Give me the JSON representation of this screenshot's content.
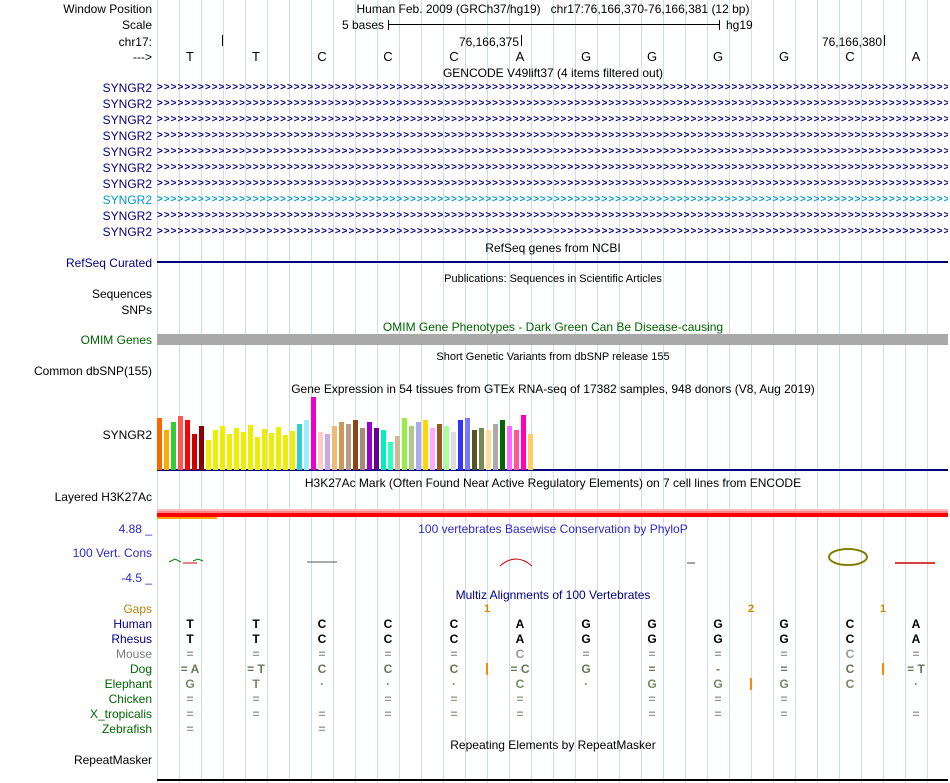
{
  "header": {
    "window_position_label": "Window Position",
    "assembly_text": "Human Feb. 2009 (GRCh37/hg19)",
    "position_text": "chr17:76,166,370-76,166,381 (12 bp)",
    "scale_label": "Scale",
    "scale_bar_text": "5 bases",
    "scale_right_text": "hg19",
    "chrom_label": "chr17:",
    "ruler_labels": [
      "76,166,375",
      "76,166,380"
    ],
    "strand_label": "--->",
    "bases": [
      "T",
      "T",
      "C",
      "C",
      "C",
      "A",
      "G",
      "G",
      "G",
      "G",
      "C",
      "A"
    ]
  },
  "gencode": {
    "title": "GENCODE V49lift37 (4 items filtered out)",
    "genes": [
      {
        "label": "SYNGR2",
        "color": "#000080"
      },
      {
        "label": "SYNGR2",
        "color": "#000080"
      },
      {
        "label": "SYNGR2",
        "color": "#000080"
      },
      {
        "label": "SYNGR2",
        "color": "#000080"
      },
      {
        "label": "SYNGR2",
        "color": "#000080"
      },
      {
        "label": "SYNGR2",
        "color": "#000080"
      },
      {
        "label": "SYNGR2",
        "color": "#000080"
      },
      {
        "label": "SYNGR2",
        "color": "#009ACD"
      },
      {
        "label": "SYNGR2",
        "color": "#000080"
      },
      {
        "label": "SYNGR2",
        "color": "#000080"
      }
    ]
  },
  "refseq": {
    "title": "RefSeq genes from NCBI",
    "label": "RefSeq Curated",
    "color": "#000080"
  },
  "publications": {
    "title": "Publications: Sequences in Scientific Articles",
    "row_labels": [
      "Sequences",
      "SNPs"
    ]
  },
  "omim": {
    "title": "OMIM Gene Phenotypes - Dark Green Can Be Disease-causing",
    "label": "OMIM Genes",
    "bar_color": "#A9A9A9"
  },
  "dbsnp": {
    "title": "Short Genetic Variants from dbSNP release 155",
    "label": "Common dbSNP(155)"
  },
  "gtex": {
    "title": "Gene Expression in 54 tissues from GTEx RNA-seq of 17382 samples, 948 donors (V8, Aug 2019)",
    "label": "SYNGR2",
    "baseline_color": "#000080",
    "bars": [
      [
        52,
        "#FF6600"
      ],
      [
        40,
        "#FFAA00"
      ],
      [
        48,
        "#33CC33"
      ],
      [
        54,
        "#FF5555"
      ],
      [
        50,
        "#FF0000"
      ],
      [
        36,
        "#CC0000"
      ],
      [
        44,
        "#8B0000"
      ],
      [
        30,
        "#EEEE00"
      ],
      [
        40,
        "#EEEE00"
      ],
      [
        44,
        "#EEEE00"
      ],
      [
        36,
        "#EEEE00"
      ],
      [
        42,
        "#EEEE00"
      ],
      [
        38,
        "#EEEE00"
      ],
      [
        45,
        "#EEEE00"
      ],
      [
        33,
        "#EEEE00"
      ],
      [
        41,
        "#EEEE00"
      ],
      [
        37,
        "#EEEE00"
      ],
      [
        43,
        "#EEEE00"
      ],
      [
        35,
        "#EEEE00"
      ],
      [
        39,
        "#EEEE00"
      ],
      [
        46,
        "#33CCCC"
      ],
      [
        50,
        "#99EEFF"
      ],
      [
        73,
        "#EE00CC"
      ],
      [
        38,
        "#FFCCCC"
      ],
      [
        36,
        "#CCAADD"
      ],
      [
        44,
        "#EEBB77"
      ],
      [
        48,
        "#CC9955"
      ],
      [
        46,
        "#BB9988"
      ],
      [
        50,
        "#8B4513"
      ],
      [
        42,
        "#AA8877"
      ],
      [
        48,
        "#9900CC"
      ],
      [
        42,
        "#660099"
      ],
      [
        40,
        "#00EEBB"
      ],
      [
        28,
        "#33FFC2"
      ],
      [
        34,
        "#CCBB99"
      ],
      [
        52,
        "#99EE44"
      ],
      [
        44,
        "#AACC88"
      ],
      [
        48,
        "#AAAAEE"
      ],
      [
        50,
        "#FFD700"
      ],
      [
        42,
        "#FFAAFF"
      ],
      [
        46,
        "#995522"
      ],
      [
        44,
        "#AAFF99"
      ],
      [
        38,
        "#DDDDDD"
      ],
      [
        50,
        "#3333FF"
      ],
      [
        52,
        "#7777FF"
      ],
      [
        40,
        "#555522"
      ],
      [
        42,
        "#778855"
      ],
      [
        40,
        "#FFDD99"
      ],
      [
        46,
        "#AAAAAA"
      ],
      [
        50,
        "#006600"
      ],
      [
        44,
        "#FF66FF"
      ],
      [
        40,
        "#FF5599"
      ],
      [
        55,
        "#FF00BB"
      ],
      [
        36,
        "#FFCC66"
      ]
    ]
  },
  "h3k27ac": {
    "title": "H3K27Ac Mark (Often Found Near Active Regulatory Elements) on 7 cell lines from ENCODE",
    "label": "Layered H3K27Ac"
  },
  "phylop": {
    "title": "100 vertebrates Basewise Conservation by PhyloP",
    "label": "100 Vert. Cons",
    "max_label": "4.88 _",
    "min_label": "-4.5 _"
  },
  "multiz": {
    "title": "Multiz Alignments of 100 Vertebrates",
    "gaps": {
      "label": "Gaps",
      "color": "#CC8800",
      "marks": [
        {
          "boundary": 5,
          "text": "1"
        },
        {
          "boundary": 9,
          "text": "2"
        },
        {
          "boundary": 11,
          "text": "1"
        }
      ]
    },
    "species": [
      {
        "name": "Human",
        "label_color": "#000080",
        "base_color": "#000000",
        "bases": [
          "T",
          "T",
          "C",
          "C",
          "C",
          "A",
          "G",
          "G",
          "G",
          "G",
          "C",
          "A"
        ],
        "inserts": []
      },
      {
        "name": "Rhesus",
        "label_color": "#000080",
        "base_color": "#000000",
        "bases": [
          "T",
          "T",
          "C",
          "C",
          "C",
          "A",
          "G",
          "G",
          "G",
          "G",
          "C",
          "A"
        ],
        "inserts": []
      },
      {
        "name": "Mouse",
        "label_color": "#7A7A7A",
        "base_color": "#999999",
        "bases": [
          "=",
          "=",
          "=",
          "=",
          "=",
          "C",
          "=",
          "=",
          "=",
          "=",
          "C",
          "="
        ],
        "inserts": []
      },
      {
        "name": "Dog",
        "label_color": "#006400",
        "base_color": "#667755",
        "bases": [
          "= A",
          "= T",
          "C",
          "C",
          "C",
          "= C",
          "G",
          "=",
          "-",
          "=",
          "C",
          "= T"
        ],
        "inserts": [
          5,
          11
        ]
      },
      {
        "name": "Elephant",
        "label_color": "#006400",
        "base_color": "#778866",
        "bases": [
          "G",
          "T",
          "·",
          "·",
          "·",
          "C",
          "·",
          "G",
          "G",
          "G",
          "C",
          "·"
        ],
        "inserts": [
          9
        ]
      },
      {
        "name": "Chicken",
        "label_color": "#006400",
        "base_color": "#8FA08F",
        "bases": [
          "=",
          "=",
          "",
          "=",
          "=",
          "=",
          "",
          "=",
          "=",
          "=",
          "",
          ""
        ],
        "inserts": []
      },
      {
        "name": "X_tropicalis",
        "label_color": "#006400",
        "base_color": "#8FA08F",
        "bases": [
          "=",
          "=",
          "=",
          "=",
          "=",
          "=",
          "",
          "=",
          "=",
          "=",
          "",
          "="
        ],
        "inserts": []
      },
      {
        "name": "Zebrafish",
        "label_color": "#006400",
        "base_color": "#8FA08F",
        "bases": [
          "=",
          "",
          "=",
          "",
          "",
          "",
          "",
          "",
          "",
          "",
          "",
          ""
        ],
        "inserts": []
      }
    ]
  },
  "repeatmasker": {
    "title": "Repeating Elements by RepeatMasker",
    "label": "RepeatMasker"
  }
}
